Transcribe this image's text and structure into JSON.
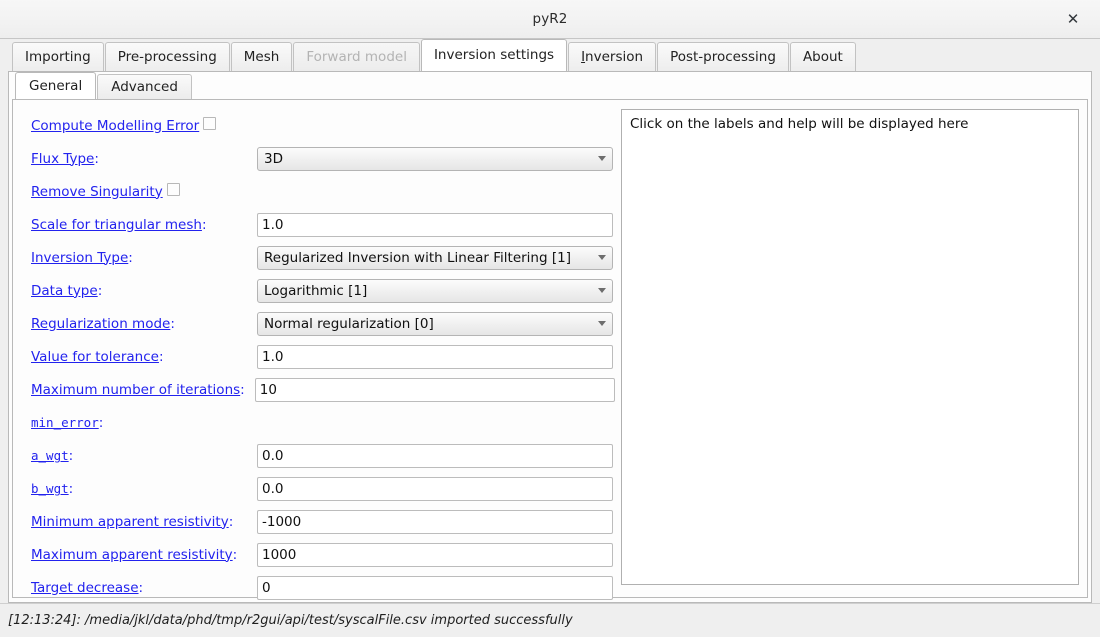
{
  "window": {
    "title": "pyR2",
    "close_icon": "close-icon",
    "close_glyph": "✕"
  },
  "tabs": [
    {
      "label": "Importing",
      "state": "normal",
      "mnemonic": ""
    },
    {
      "label": "Pre-processing",
      "state": "normal",
      "mnemonic": ""
    },
    {
      "label": "Mesh",
      "state": "normal",
      "mnemonic": ""
    },
    {
      "label": "Forward model",
      "state": "disabled",
      "mnemonic": ""
    },
    {
      "label": "Inversion settings",
      "state": "active",
      "mnemonic": ""
    },
    {
      "label": "Inversion",
      "state": "normal",
      "mnemonic": "I"
    },
    {
      "label": "Post-processing",
      "state": "normal",
      "mnemonic": ""
    },
    {
      "label": "About",
      "state": "normal",
      "mnemonic": ""
    }
  ],
  "subtabs": [
    {
      "label": "General",
      "state": "active"
    },
    {
      "label": "Advanced",
      "state": "normal"
    }
  ],
  "form": {
    "rows": [
      {
        "label": "Compute Modelling Error",
        "colon": "",
        "mono": false,
        "type": "checkbox",
        "checked": false,
        "width": "main"
      },
      {
        "label": "Flux Type",
        "colon": ":",
        "mono": false,
        "type": "combo",
        "value": "3D",
        "width": "main"
      },
      {
        "label": "Remove Singularity",
        "colon": "",
        "mono": false,
        "type": "checkbox",
        "checked": false,
        "width": "main"
      },
      {
        "label": "Scale for triangular mesh",
        "colon": ":",
        "mono": false,
        "type": "text",
        "value": "1.0",
        "width": "main"
      },
      {
        "label": "Inversion Type",
        "colon": ":",
        "mono": false,
        "type": "combo",
        "value": "Regularized Inversion with Linear Filtering [1]",
        "width": "main"
      },
      {
        "label": "Data type",
        "colon": ":",
        "mono": false,
        "type": "combo",
        "value": "Logarithmic [1]",
        "width": "main"
      },
      {
        "label": "Regularization mode",
        "colon": ":",
        "mono": false,
        "type": "combo",
        "value": "Normal regularization [0]",
        "width": "main"
      },
      {
        "label": "Value for tolerance",
        "colon": ":",
        "mono": false,
        "type": "text",
        "value": "1.0",
        "width": "main"
      },
      {
        "label": "Maximum number of iterations",
        "colon": ":",
        "mono": false,
        "type": "text",
        "value": "10",
        "width": "wide"
      },
      {
        "label": "min_error",
        "colon": ":",
        "mono": true,
        "type": "none",
        "value": "",
        "width": "main"
      },
      {
        "label": "a_wgt",
        "colon": ":",
        "mono": true,
        "type": "text",
        "value": "0.0",
        "width": "main"
      },
      {
        "label": "b_wgt",
        "colon": ":",
        "mono": true,
        "type": "text",
        "value": "0.0",
        "width": "main"
      },
      {
        "label": "Minimum apparent resistivity",
        "colon": ":",
        "mono": false,
        "type": "text",
        "value": "-1000",
        "width": "main"
      },
      {
        "label": "Maximum apparent resistivity",
        "colon": ":",
        "mono": false,
        "type": "text",
        "value": "1000",
        "width": "main"
      },
      {
        "label": "Target decrease",
        "colon": ":",
        "mono": false,
        "type": "text",
        "value": "0",
        "width": "main"
      }
    ]
  },
  "help": {
    "text": "Click on the labels and help will be displayed here"
  },
  "statusbar": {
    "text": "[12:13:24]: /media/jkl/data/phd/tmp/r2gui/api/test/syscalFile.csv imported successfully"
  },
  "colors": {
    "link": "#2222ee",
    "window_bg": "#efefef",
    "panel_bg": "#fdfdfd",
    "input_bg": "#ffffff",
    "border": "#b9b9b9",
    "disabled_text": "#b3b3b3"
  }
}
